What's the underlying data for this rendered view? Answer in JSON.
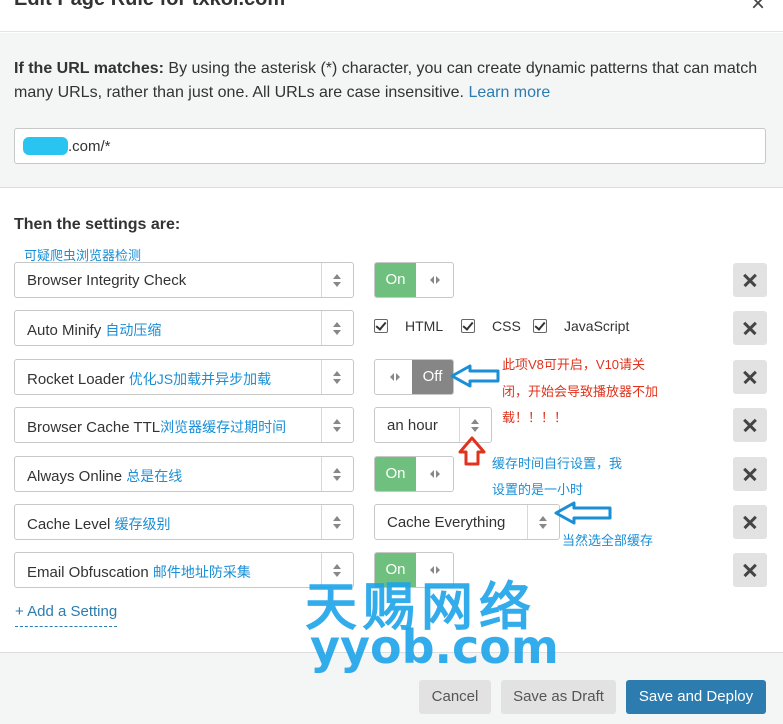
{
  "header": {
    "title": "Edit Page Rule for txkoi.com"
  },
  "intro": {
    "bold": "If the URL matches:",
    "text": " By using the asterisk (*) character, you can create dynamic patterns that can match many URLs, rather than just one. All URLs are case insensitive. ",
    "link": "Learn more"
  },
  "url": {
    "value": ".com/*"
  },
  "settings_title": "Then the settings are:",
  "rows": [
    {
      "label": "Browser Integrity Check",
      "cn": "",
      "above": "可疑爬虫浏览器检测",
      "control": "On"
    },
    {
      "label": "Auto Minify ",
      "cn": "自动压缩",
      "control": ""
    },
    {
      "label": "Rocket Loader ",
      "cn": "优化JS加载并异步加载",
      "control": "Off"
    },
    {
      "label": "Browser Cache TTL",
      "cn": "浏览器缓存过期时间",
      "control": "an hour"
    },
    {
      "label": "Always Online ",
      "cn": "总是在线",
      "control": "On"
    },
    {
      "label": "Cache Level ",
      "cn": "缓存级别",
      "control": "Cache Everything"
    },
    {
      "label": "Email Obfuscation ",
      "cn": "邮件地址防采集",
      "control": "On"
    }
  ],
  "minify": [
    "HTML",
    "CSS",
    "JavaScript"
  ],
  "notes": {
    "rocket_line1": "此项V8可开启，V10请关",
    "rocket_line2": "闭，开始会导致播放器不加",
    "rocket_line3": "载！！！！",
    "ttl_line1": "缓存时间自行设置，我",
    "ttl_line2": "设置的是一小时",
    "cache_level": "当然选全部缓存"
  },
  "add_setting": "+ Add a Setting",
  "footer": {
    "cancel": "Cancel",
    "draft": "Save as Draft",
    "deploy": "Save and Deploy"
  },
  "watermark": {
    "line1": "天赐网络",
    "line2": "yyob.com"
  },
  "colors": {
    "accent": "#2c7cb0",
    "on": "#6fc07e",
    "off": "#868686",
    "annotation_blue": "#1a8fd6",
    "annotation_red": "#e0321c"
  }
}
